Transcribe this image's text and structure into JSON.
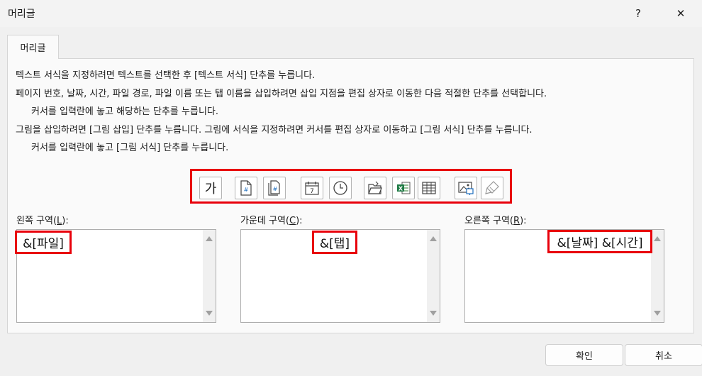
{
  "window": {
    "title": "머리글",
    "help_label": "?",
    "close_label": "✕"
  },
  "tab": {
    "label": "머리글"
  },
  "instructions": [
    "텍스트 서식을 지정하려면 텍스트를 선택한 후 [텍스트 서식] 단추를 누릅니다.",
    "페이지 번호, 날짜, 시간, 파일 경로, 파일 이름 또는 탭 이름을 삽입하려면 삽입 지점을 편집 상자로 이동한 다음 적절한 단추를 선택합니다.",
    "커서를 입력란에 놓고 해당하는 단추를 누릅니다.",
    "그림을 삽입하려면 [그림 삽입] 단추를 누릅니다.  그림에 서식을 지정하려면 커서를 편집 상자로 이동하고 [그림 서식] 단추를 누릅니다.",
    "커서를 입력란에 놓고 [그림 서식] 단추를 누릅니다."
  ],
  "toolbar": {
    "format_text_glyph": "가",
    "highlight_color": "#e8000b",
    "buttons": [
      "format-text-icon",
      "page-number-icon",
      "number-of-pages-icon",
      "date-icon",
      "time-icon",
      "file-path-icon",
      "file-name-icon",
      "sheet-name-icon",
      "insert-picture-icon",
      "format-picture-icon"
    ]
  },
  "sections": {
    "left": {
      "label": "왼쪽 구역(",
      "hotkey": "L",
      "suffix": "):",
      "value": "&[파일]"
    },
    "center": {
      "label": "가운데 구역(",
      "hotkey": "C",
      "suffix": "):",
      "value": "&[탭]"
    },
    "right": {
      "label": "오른쪽 구역(",
      "hotkey": "R",
      "suffix": "):",
      "value": "&[날짜] &[시간]"
    }
  },
  "buttons": {
    "ok": "확인",
    "cancel": "취소"
  }
}
